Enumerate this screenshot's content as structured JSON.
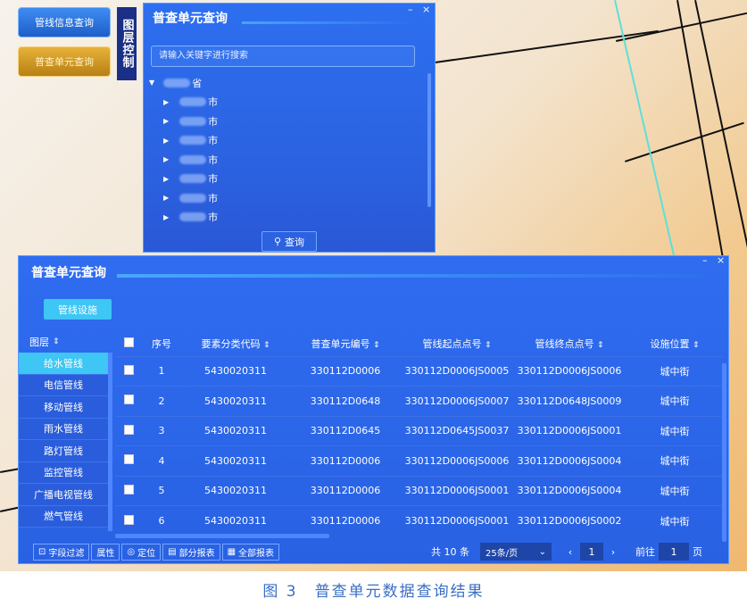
{
  "left_buttons": {
    "pipeline_info": "管线信息查询",
    "census_unit": "普查单元查询"
  },
  "layer_control": "图层控制",
  "query_panel": {
    "title": "普查单元查询",
    "search_placeholder": "请输入关键字进行搜索",
    "tree_root": "省",
    "tree_children": [
      "市",
      "市",
      "市",
      "市",
      "市",
      "市",
      "市"
    ],
    "query_button": "查询"
  },
  "result_panel": {
    "title": "普查单元查询",
    "tab": "管线设施",
    "layer_header": "图层",
    "layers": [
      "给水管线",
      "电信管线",
      "移动管线",
      "雨水管线",
      "路灯管线",
      "监控管线",
      "广播电视管线",
      "燃气管线"
    ],
    "columns": [
      "序号",
      "要素分类代码",
      "普查单元编号",
      "管线起点点号",
      "管线终点点号",
      "设施位置"
    ],
    "rows": [
      [
        "1",
        "5430020311",
        "330112D0006",
        "330112D0006JS0005",
        "330112D0006JS0006",
        "城中街"
      ],
      [
        "2",
        "5430020311",
        "330112D0648",
        "330112D0006JS0007",
        "330112D0648JS0009",
        "城中街"
      ],
      [
        "3",
        "5430020311",
        "330112D0645",
        "330112D0645JS0037",
        "330112D0006JS0001",
        "城中街"
      ],
      [
        "4",
        "5430020311",
        "330112D0006",
        "330112D0006JS0006",
        "330112D0006JS0004",
        "城中街"
      ],
      [
        "5",
        "5430020311",
        "330112D0006",
        "330112D0006JS0001",
        "330112D0006JS0004",
        "城中街"
      ],
      [
        "6",
        "5430020311",
        "330112D0006",
        "330112D0006JS0001",
        "330112D0006JS0002",
        "城中街"
      ]
    ],
    "footer_buttons": [
      "字段过滤",
      "属性",
      "定位",
      "部分报表",
      "全部报表"
    ],
    "pager": {
      "total": "共 10 条",
      "page_size": "25条/页",
      "current_page": "1",
      "goto_label": "前往",
      "goto_value": "1",
      "page_unit": "页"
    }
  },
  "caption": "图 3　普查单元数据查询结果"
}
